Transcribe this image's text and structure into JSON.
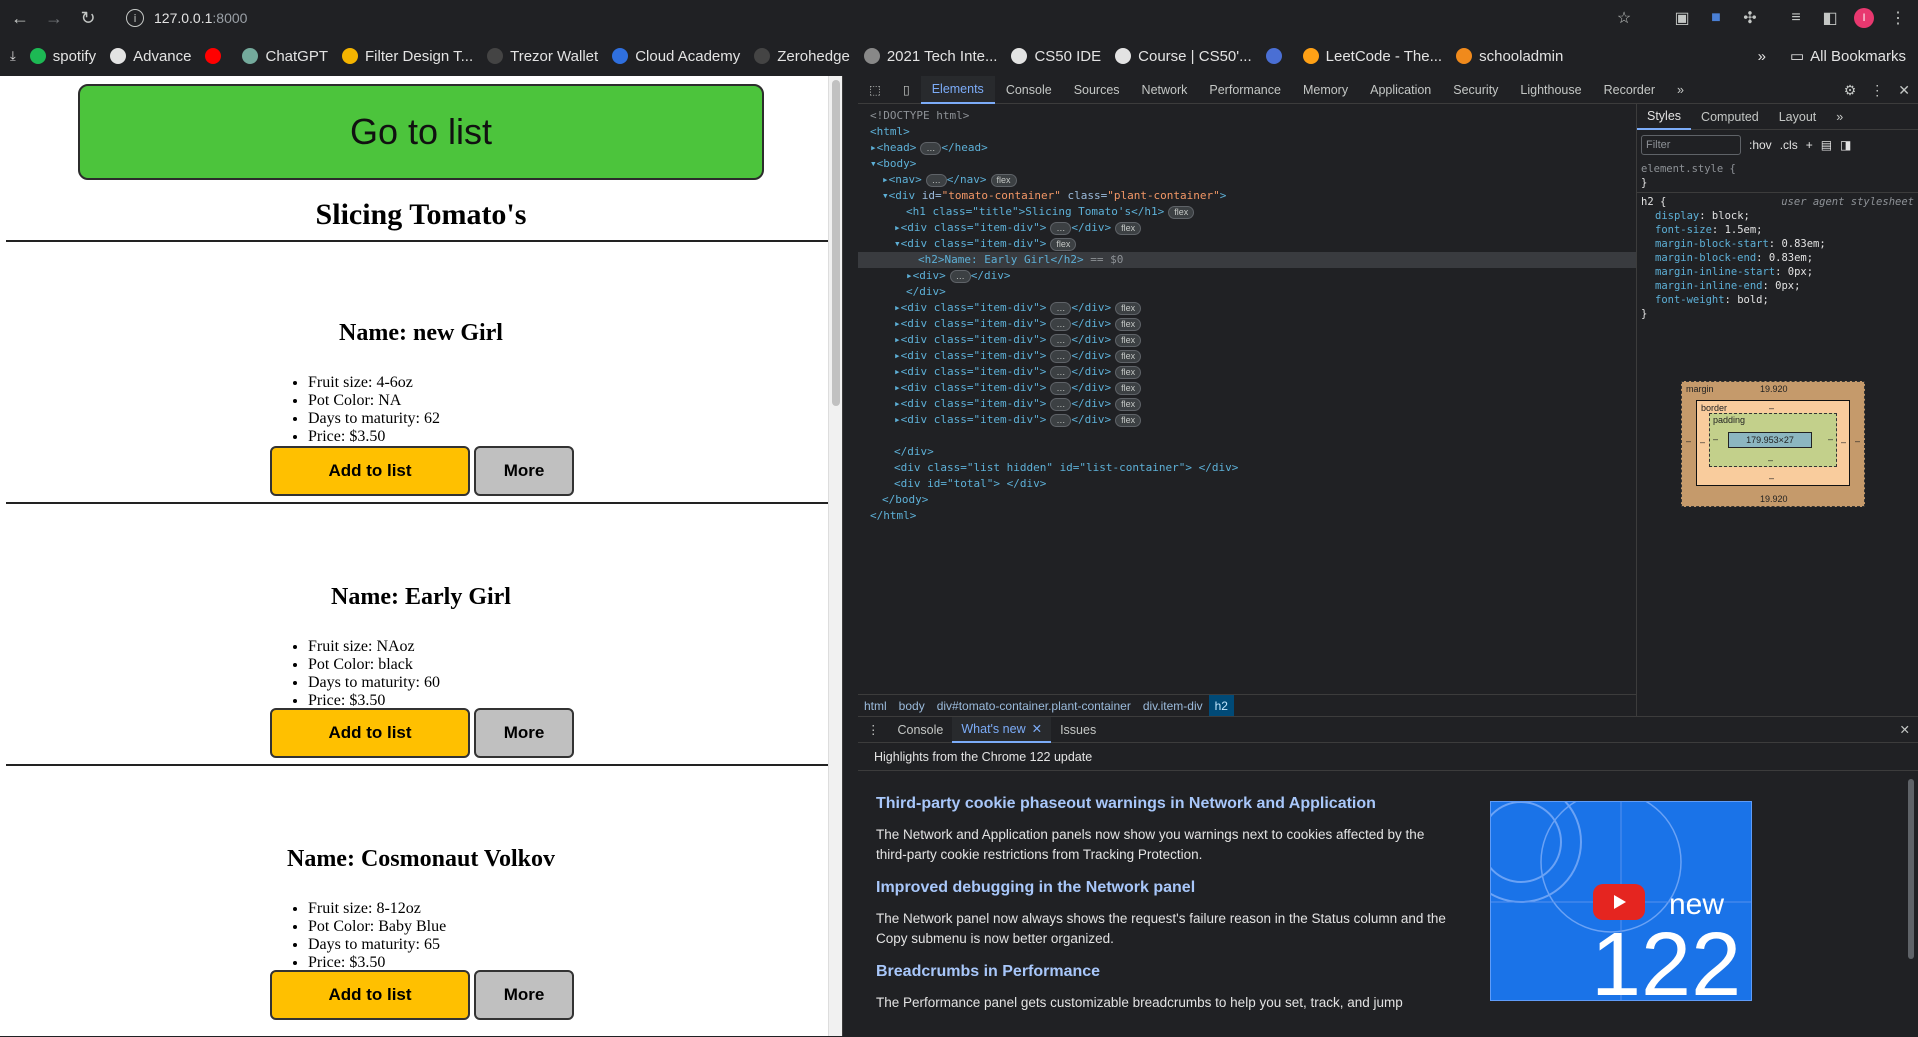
{
  "browser": {
    "url_host": "127.0.0.1",
    "url_port": ":8000",
    "profile_initial": "I"
  },
  "bookmarks": {
    "items": [
      {
        "label": "spotify",
        "color": "#1db954"
      },
      {
        "label": "Advance",
        "color": "#e3e3e3"
      },
      {
        "label": "",
        "color": "#ff0000"
      },
      {
        "label": "ChatGPT",
        "color": "#74aa9c"
      },
      {
        "label": "Filter Design T...",
        "color": "#f4b400"
      },
      {
        "label": "Trezor Wallet",
        "color": "#444444"
      },
      {
        "label": "Cloud Academy",
        "color": "#2f6fde"
      },
      {
        "label": "Zerohedge",
        "color": "#444444"
      },
      {
        "label": "2021 Tech Inte...",
        "color": "#888888"
      },
      {
        "label": "CS50 IDE",
        "color": "#e3e3e3"
      },
      {
        "label": "Course | CS50'...",
        "color": "#e3e3e3"
      },
      {
        "label": "",
        "color": "#4a6fd4"
      },
      {
        "label": "LeetCode - The...",
        "color": "#ffa116"
      },
      {
        "label": "schooladmin",
        "color": "#f08a1c"
      }
    ],
    "all_bookmarks": "All Bookmarks",
    "overflow": "»"
  },
  "page": {
    "goto_label": "Go to list",
    "title": "Slicing Tomato's",
    "add_label": "Add to list",
    "more_label": "More",
    "items": [
      {
        "name": "Name: new Girl",
        "details": [
          "Fruit size: 4-6oz",
          "Pot Color: NA",
          "Days to maturity: 62",
          "Price: $3.50"
        ]
      },
      {
        "name": "Name: Early Girl",
        "details": [
          "Fruit size: NAoz",
          "Pot Color: black",
          "Days to maturity: 60",
          "Price: $3.50"
        ]
      },
      {
        "name": "Name: Cosmonaut Volkov",
        "details": [
          "Fruit size: 8-12oz",
          "Pot Color: Baby Blue",
          "Days to maturity: 65",
          "Price: $3.50"
        ]
      }
    ]
  },
  "devtools": {
    "tabs": [
      "Elements",
      "Console",
      "Sources",
      "Network",
      "Performance",
      "Memory",
      "Application",
      "Security",
      "Lighthouse",
      "Recorder"
    ],
    "active_tab": "Elements",
    "code": {
      "doctype": "<!DOCTYPE html>",
      "html_open": "<html>",
      "head": "<head>",
      "head_close": "</head>",
      "body_open": "<body>",
      "nav": "<nav>",
      "nav_close": "</nav>",
      "flex": "flex",
      "container_open_tag": "<div ",
      "container_id_attr": "id=",
      "container_id_val": "\"tomato-container\"",
      "container_class_attr": " class=",
      "container_class_val": "\"plant-container\"",
      "h1_line": "<h1 class=\"title\">Slicing Tomato's</h1>",
      "item_div": "<div class=\"item-div\">",
      "div_close": "</div>",
      "h2_selected": "<h2>Name: Early Girl</h2>",
      "selected_marker": "== $0",
      "inner_div": "<div>",
      "list_div": "<div class=\"list hidden\" id=\"list-container\"> </div>",
      "total_div": "<div id=\"total\"> </div>",
      "body_close": "</body>",
      "html_close": "</html>"
    },
    "breadcrumbs": [
      "html",
      "body",
      "div#tomato-container.plant-container",
      "div.item-div",
      "h2"
    ],
    "styles_tabs": [
      "Styles",
      "Computed",
      "Layout"
    ],
    "filter_placeholder": "Filter",
    "hov": ":hov",
    "cls": ".cls",
    "element_style": "element.style {",
    "close_brace": "}",
    "h2_selector": "h2 {",
    "ua_label": "user agent stylesheet",
    "css_props": [
      {
        "prop": "display",
        "value": "block;"
      },
      {
        "prop": "font-size",
        "value": "1.5em;"
      },
      {
        "prop": "margin-block-start",
        "value": "0.83em;"
      },
      {
        "prop": "margin-block-end",
        "value": "0.83em;"
      },
      {
        "prop": "margin-inline-start",
        "value": "0px;"
      },
      {
        "prop": "margin-inline-end",
        "value": "0px;"
      },
      {
        "prop": "font-weight",
        "value": "bold;"
      }
    ],
    "box_model": {
      "margin_label": "margin",
      "margin_top": "19.920",
      "margin_bottom": "19.920",
      "border_label": "border",
      "padding_label": "padding",
      "dash": "–",
      "content_size": "179.953×27"
    },
    "drawer_tabs": [
      "Console",
      "What's new",
      "Issues"
    ],
    "drawer_active": "What's new",
    "highlights": "Highlights from the Chrome 122 update",
    "news": [
      {
        "title": "Third-party cookie phaseout warnings in Network and Application",
        "body": "The Network and Application panels now show you warnings next to cookies affected by the third-party cookie restrictions from Tracking Protection."
      },
      {
        "title": "Improved debugging in the Network panel",
        "body": "The Network panel now always shows the request's failure reason in the Status column and the Copy submenu is now better organized."
      },
      {
        "title": "Breadcrumbs in Performance",
        "body": "The Performance panel gets customizable breadcrumbs to help you set, track, and jump"
      }
    ],
    "promo_new": "new",
    "promo_version": "122"
  }
}
